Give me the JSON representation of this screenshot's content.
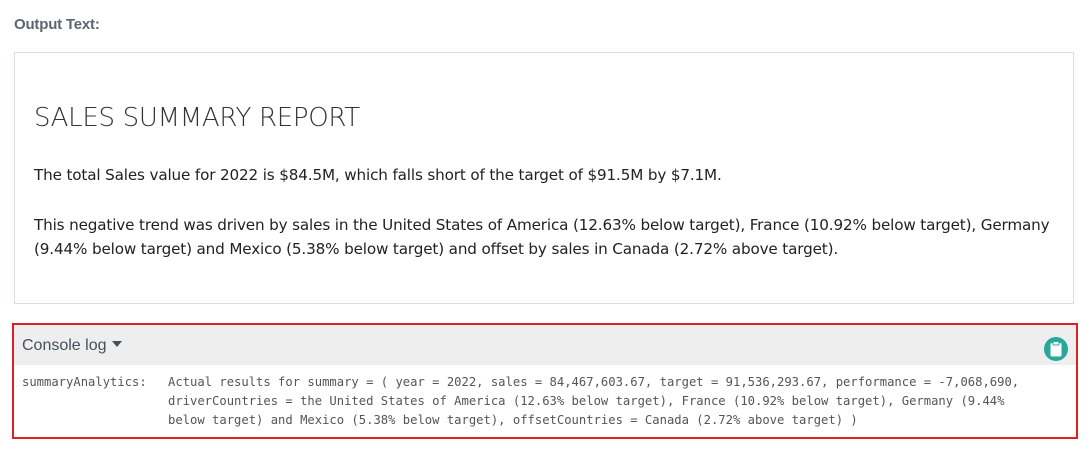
{
  "output": {
    "label": "Output Text:",
    "report_title": "SALES SUMMARY REPORT",
    "paragraph_1": "The total Sales value for 2022 is $84.5M, which falls short of the target of $91.5M by $7.1M.",
    "paragraph_2": "This negative trend was driven by sales in the United States of America (12.63% below target), France (10.92% below target), Germany (9.44% below target) and Mexico (5.38% below target) and offset by sales in Canada (2.72% above target)."
  },
  "console": {
    "title": "Console log",
    "copy_icon": "clipboard-icon",
    "accent_color": "#26a99a",
    "highlight_color": "#e02020",
    "log_prefix": "summaryAnalytics:",
    "log_lines": [
      "Actual results for summary = ( year = 2022, sales = 84,467,603.67, target = 91,536,293.67, performance = -7,068,690,",
      "driverCountries = the United States of America (12.63% below target), France (10.92% below target), Germany (9.44%",
      "below target) and Mexico (5.38% below target), offsetCountries = Canada (2.72% above target) )"
    ]
  }
}
